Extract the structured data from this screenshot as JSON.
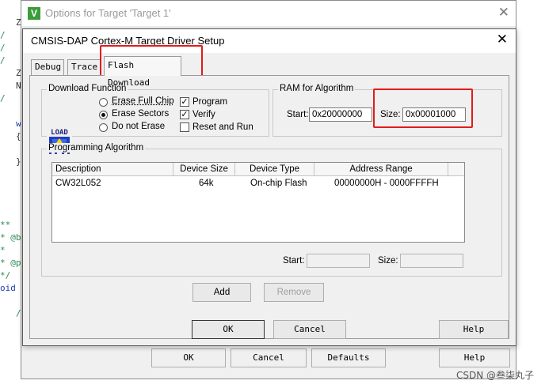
{
  "editor": {
    "fragments": [
      "Z",
      "/",
      "/",
      "/",
      "Z",
      "N",
      "/",
      "w",
      "{",
      "}",
      "**",
      "* @b",
      "*",
      "* @p",
      "*/",
      "oid",
      "/"
    ]
  },
  "outer_window": {
    "logo_letter": "V",
    "title": "Options for Target 'Target 1'",
    "buttons": {
      "ok": "OK",
      "cancel": "Cancel",
      "defaults": "Defaults",
      "help": "Help"
    }
  },
  "dialog": {
    "title": "CMSIS-DAP Cortex-M Target Driver Setup",
    "tabs": [
      {
        "label": "Debug"
      },
      {
        "label": "Trace"
      },
      {
        "label": "Flash Download"
      }
    ],
    "download_function": {
      "label": "Download Function",
      "icon_text": "LOAD",
      "radios": [
        {
          "label": "Erase Full Chip",
          "selected": false
        },
        {
          "label": "Erase Sectors",
          "selected": true
        },
        {
          "label": "Do not Erase",
          "selected": false
        }
      ],
      "checks": [
        {
          "label": "Program",
          "checked": true
        },
        {
          "label": "Verify",
          "checked": true
        },
        {
          "label": "Reset and Run",
          "checked": false
        }
      ]
    },
    "ram": {
      "label": "RAM for Algorithm",
      "start_label": "Start:",
      "start_value": "0x20000000",
      "size_label": "Size:",
      "size_value": "0x00001000"
    },
    "programming": {
      "label": "Programming Algorithm",
      "columns": [
        "Description",
        "Device Size",
        "Device Type",
        "Address Range"
      ],
      "rows": [
        {
          "description": "CW32L052",
          "size": "64k",
          "type": "On-chip Flash",
          "range": "00000000H - 0000FFFFH"
        }
      ],
      "start_label": "Start:",
      "size_label": "Size:",
      "start_value": "",
      "size_value": ""
    },
    "buttons": {
      "add": "Add",
      "remove": "Remove",
      "ok": "OK",
      "cancel": "Cancel",
      "help": "Help"
    }
  },
  "watermark": "CSDN @叁柒丸子",
  "colors": {
    "highlight": "#e31b1b",
    "logo": "#3a9d3a"
  }
}
